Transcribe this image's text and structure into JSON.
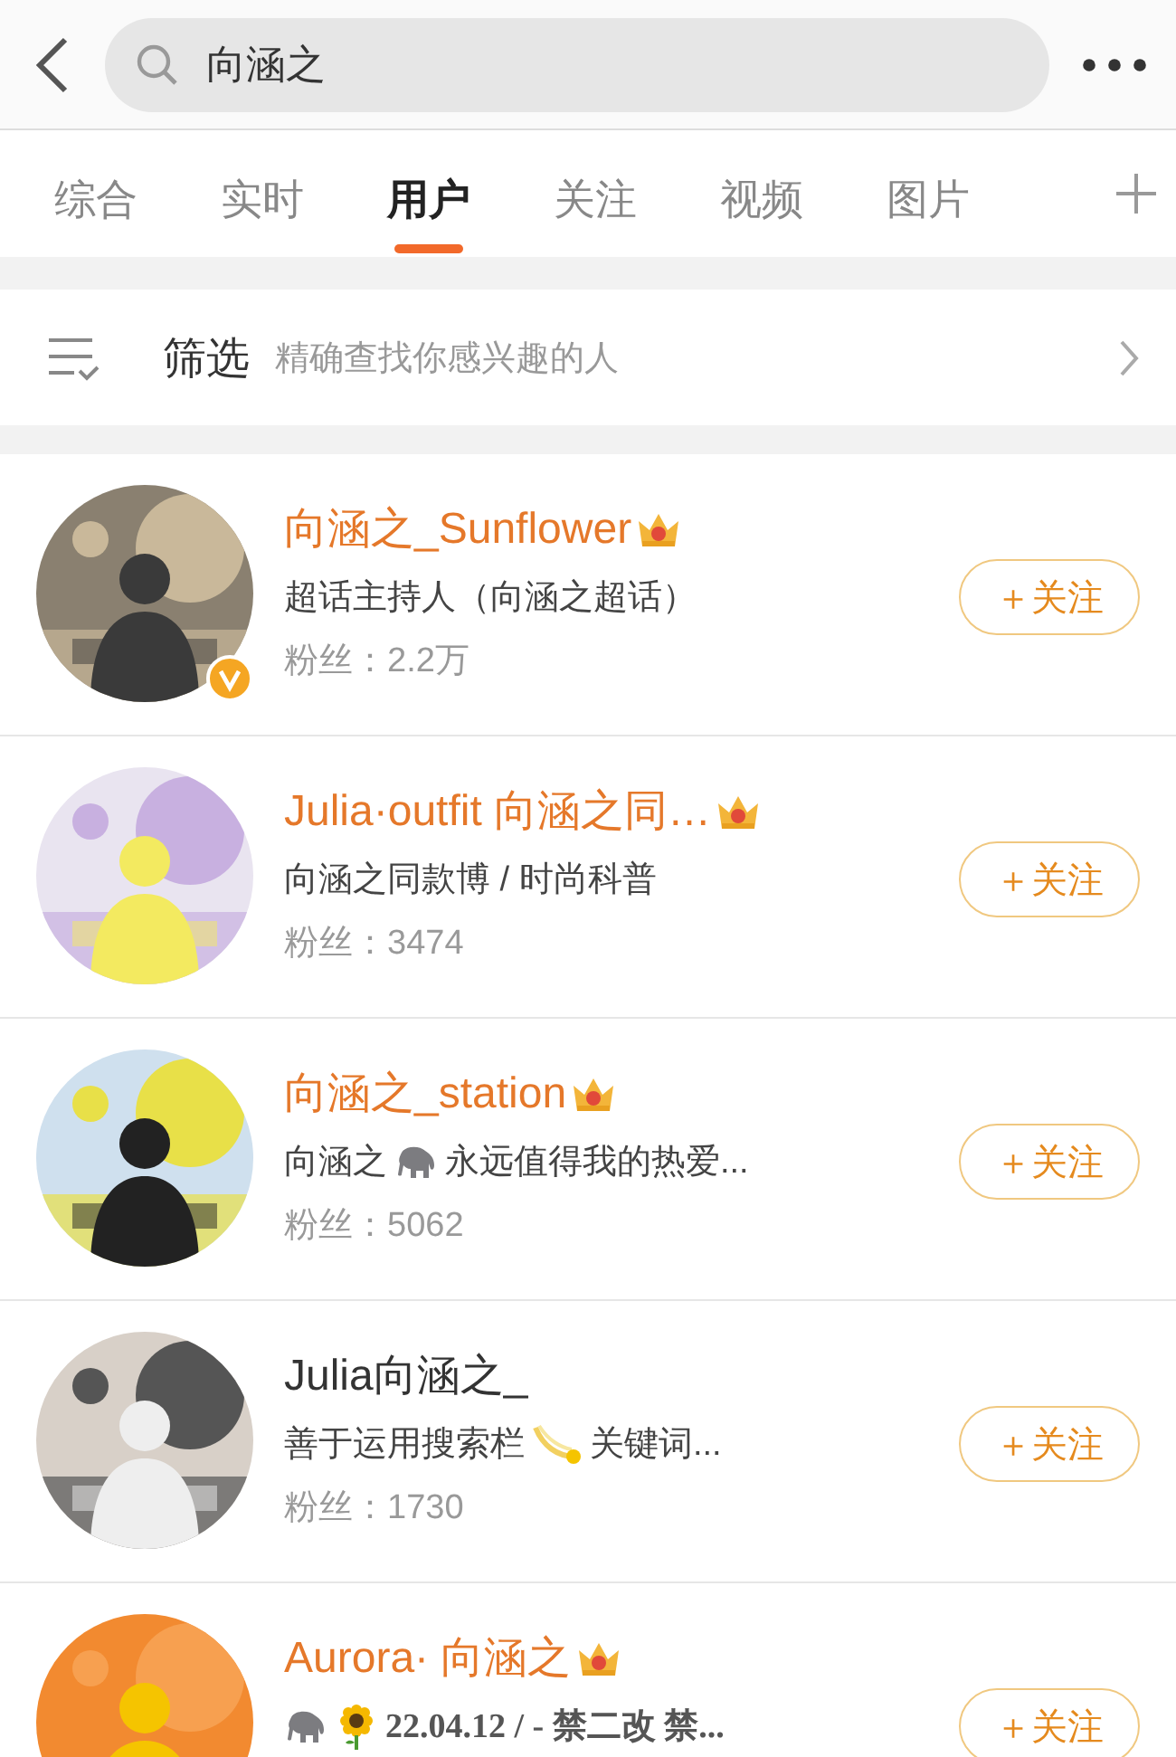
{
  "search": {
    "value": "向涵之"
  },
  "tabs": [
    {
      "label": "综合",
      "selected": false
    },
    {
      "label": "实时",
      "selected": false
    },
    {
      "label": "用户",
      "selected": true
    },
    {
      "label": "关注",
      "selected": false
    },
    {
      "label": "视频",
      "selected": false
    },
    {
      "label": "图片",
      "selected": false
    }
  ],
  "filter": {
    "label": "筛选",
    "hint": "精确查找你感兴趣的人"
  },
  "users": [
    {
      "name": "向涵之_Sunflower",
      "crown": true,
      "verified": true,
      "bio": [
        {
          "kind": "text",
          "text": "超话主持人（向涵之超话）"
        }
      ],
      "fans": "粉丝：2.2万",
      "button": "＋关注"
    },
    {
      "name": "Julia·outfit 向涵之同…",
      "crown": true,
      "verified": false,
      "bio": [
        {
          "kind": "text",
          "text": "向涵之同款博 / 时尚科普"
        }
      ],
      "fans": "粉丝：3474",
      "button": "＋关注"
    },
    {
      "name": "向涵之_station",
      "crown": true,
      "verified": false,
      "bio": [
        {
          "kind": "text",
          "text": "向涵之"
        },
        {
          "kind": "elephant"
        },
        {
          "kind": "text",
          "text": "永远值得我的热爱..."
        }
      ],
      "fans": "粉丝：5062",
      "button": "＋关注"
    },
    {
      "name": "Julia向涵之_",
      "crown": false,
      "verified": false,
      "bio": [
        {
          "kind": "text",
          "text": "善于运用搜索栏"
        },
        {
          "kind": "comet"
        },
        {
          "kind": "text",
          "text": "关键词..."
        }
      ],
      "fans": "粉丝：1730",
      "button": "＋关注"
    },
    {
      "name": "Aurora· 向涵之",
      "crown": true,
      "verified": false,
      "bio": [
        {
          "kind": "elephant"
        },
        {
          "kind": "sunflower"
        },
        {
          "kind": "text",
          "text": "22.04.12 / - 禁二改 禁..."
        }
      ],
      "button": "＋关注"
    }
  ]
}
